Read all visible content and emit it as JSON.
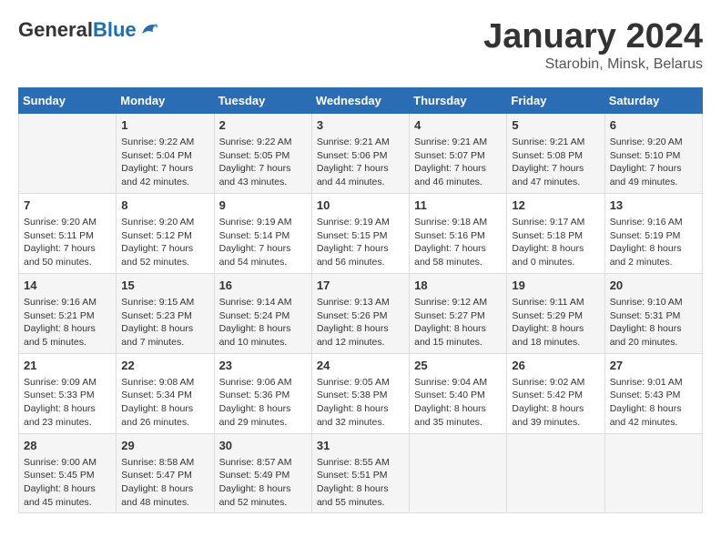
{
  "header": {
    "logo_general": "General",
    "logo_blue": "Blue",
    "month": "January 2024",
    "location": "Starobin, Minsk, Belarus"
  },
  "weekdays": [
    "Sunday",
    "Monday",
    "Tuesday",
    "Wednesday",
    "Thursday",
    "Friday",
    "Saturday"
  ],
  "weeks": [
    [
      {
        "day": "",
        "info": ""
      },
      {
        "day": "1",
        "info": "Sunrise: 9:22 AM\nSunset: 5:04 PM\nDaylight: 7 hours\nand 42 minutes."
      },
      {
        "day": "2",
        "info": "Sunrise: 9:22 AM\nSunset: 5:05 PM\nDaylight: 7 hours\nand 43 minutes."
      },
      {
        "day": "3",
        "info": "Sunrise: 9:21 AM\nSunset: 5:06 PM\nDaylight: 7 hours\nand 44 minutes."
      },
      {
        "day": "4",
        "info": "Sunrise: 9:21 AM\nSunset: 5:07 PM\nDaylight: 7 hours\nand 46 minutes."
      },
      {
        "day": "5",
        "info": "Sunrise: 9:21 AM\nSunset: 5:08 PM\nDaylight: 7 hours\nand 47 minutes."
      },
      {
        "day": "6",
        "info": "Sunrise: 9:20 AM\nSunset: 5:10 PM\nDaylight: 7 hours\nand 49 minutes."
      }
    ],
    [
      {
        "day": "7",
        "info": "Sunrise: 9:20 AM\nSunset: 5:11 PM\nDaylight: 7 hours\nand 50 minutes."
      },
      {
        "day": "8",
        "info": "Sunrise: 9:20 AM\nSunset: 5:12 PM\nDaylight: 7 hours\nand 52 minutes."
      },
      {
        "day": "9",
        "info": "Sunrise: 9:19 AM\nSunset: 5:14 PM\nDaylight: 7 hours\nand 54 minutes."
      },
      {
        "day": "10",
        "info": "Sunrise: 9:19 AM\nSunset: 5:15 PM\nDaylight: 7 hours\nand 56 minutes."
      },
      {
        "day": "11",
        "info": "Sunrise: 9:18 AM\nSunset: 5:16 PM\nDaylight: 7 hours\nand 58 minutes."
      },
      {
        "day": "12",
        "info": "Sunrise: 9:17 AM\nSunset: 5:18 PM\nDaylight: 8 hours\nand 0 minutes."
      },
      {
        "day": "13",
        "info": "Sunrise: 9:16 AM\nSunset: 5:19 PM\nDaylight: 8 hours\nand 2 minutes."
      }
    ],
    [
      {
        "day": "14",
        "info": "Sunrise: 9:16 AM\nSunset: 5:21 PM\nDaylight: 8 hours\nand 5 minutes."
      },
      {
        "day": "15",
        "info": "Sunrise: 9:15 AM\nSunset: 5:23 PM\nDaylight: 8 hours\nand 7 minutes."
      },
      {
        "day": "16",
        "info": "Sunrise: 9:14 AM\nSunset: 5:24 PM\nDaylight: 8 hours\nand 10 minutes."
      },
      {
        "day": "17",
        "info": "Sunrise: 9:13 AM\nSunset: 5:26 PM\nDaylight: 8 hours\nand 12 minutes."
      },
      {
        "day": "18",
        "info": "Sunrise: 9:12 AM\nSunset: 5:27 PM\nDaylight: 8 hours\nand 15 minutes."
      },
      {
        "day": "19",
        "info": "Sunrise: 9:11 AM\nSunset: 5:29 PM\nDaylight: 8 hours\nand 18 minutes."
      },
      {
        "day": "20",
        "info": "Sunrise: 9:10 AM\nSunset: 5:31 PM\nDaylight: 8 hours\nand 20 minutes."
      }
    ],
    [
      {
        "day": "21",
        "info": "Sunrise: 9:09 AM\nSunset: 5:33 PM\nDaylight: 8 hours\nand 23 minutes."
      },
      {
        "day": "22",
        "info": "Sunrise: 9:08 AM\nSunset: 5:34 PM\nDaylight: 8 hours\nand 26 minutes."
      },
      {
        "day": "23",
        "info": "Sunrise: 9:06 AM\nSunset: 5:36 PM\nDaylight: 8 hours\nand 29 minutes."
      },
      {
        "day": "24",
        "info": "Sunrise: 9:05 AM\nSunset: 5:38 PM\nDaylight: 8 hours\nand 32 minutes."
      },
      {
        "day": "25",
        "info": "Sunrise: 9:04 AM\nSunset: 5:40 PM\nDaylight: 8 hours\nand 35 minutes."
      },
      {
        "day": "26",
        "info": "Sunrise: 9:02 AM\nSunset: 5:42 PM\nDaylight: 8 hours\nand 39 minutes."
      },
      {
        "day": "27",
        "info": "Sunrise: 9:01 AM\nSunset: 5:43 PM\nDaylight: 8 hours\nand 42 minutes."
      }
    ],
    [
      {
        "day": "28",
        "info": "Sunrise: 9:00 AM\nSunset: 5:45 PM\nDaylight: 8 hours\nand 45 minutes."
      },
      {
        "day": "29",
        "info": "Sunrise: 8:58 AM\nSunset: 5:47 PM\nDaylight: 8 hours\nand 48 minutes."
      },
      {
        "day": "30",
        "info": "Sunrise: 8:57 AM\nSunset: 5:49 PM\nDaylight: 8 hours\nand 52 minutes."
      },
      {
        "day": "31",
        "info": "Sunrise: 8:55 AM\nSunset: 5:51 PM\nDaylight: 8 hours\nand 55 minutes."
      },
      {
        "day": "",
        "info": ""
      },
      {
        "day": "",
        "info": ""
      },
      {
        "day": "",
        "info": ""
      }
    ]
  ]
}
